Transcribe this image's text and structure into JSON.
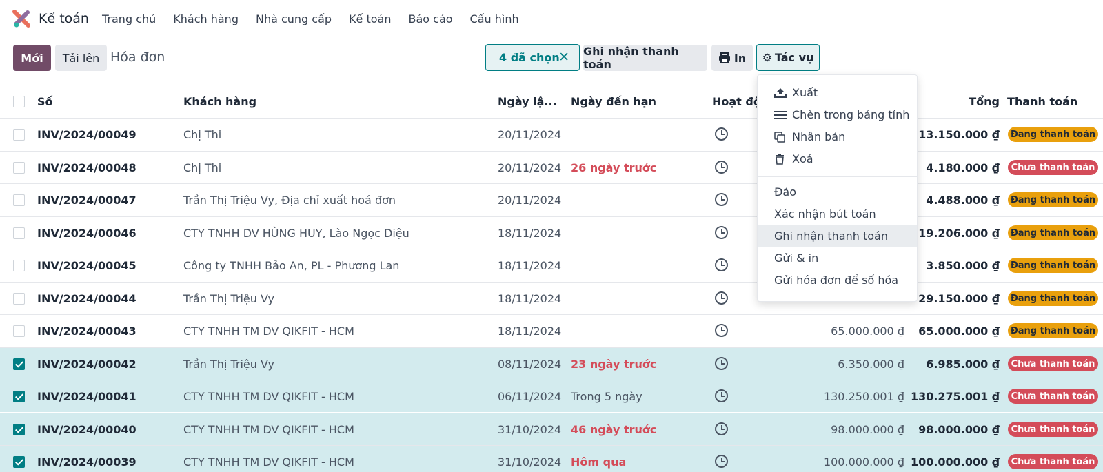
{
  "nav": {
    "app_title": "Kế toán",
    "menu": [
      "Trang chủ",
      "Khách hàng",
      "Nhà cung cấp",
      "Kế toán",
      "Báo cáo",
      "Cấu hình"
    ]
  },
  "control": {
    "new_label": "Mới",
    "upload_label": "Tải lên",
    "breadcrumb": "Hóa đơn",
    "selected_label": "4 đã chọn",
    "register_payment_label": "Ghi nhận thanh toán",
    "print_label": "In",
    "actions_label": "Tác vụ"
  },
  "table": {
    "headers": {
      "number": "Số",
      "customer": "Khách hàng",
      "invoice_date": "Ngày lậ...",
      "due_date": "Ngày đến hạn",
      "activity": "Hoạt độn",
      "total": "Tổng",
      "payment": "Thanh toán"
    },
    "rows": [
      {
        "number": "INV/2024/00049",
        "customer": "Chị Thi",
        "date": "20/11/2024",
        "due": "",
        "untaxed": "",
        "total": "13.150.000 ₫",
        "status": "Đang thanh toán",
        "selected": false
      },
      {
        "number": "INV/2024/00048",
        "customer": "Chị Thi",
        "date": "20/11/2024",
        "due": "26 ngày trước",
        "untaxed": "",
        "total": "4.180.000 ₫",
        "status": "Chưa thanh toán",
        "selected": false
      },
      {
        "number": "INV/2024/00047",
        "customer": "Trần Thị Triệu Vy, Địa chỉ xuất hoá đơn",
        "date": "20/11/2024",
        "due": "",
        "untaxed": "",
        "total": "4.488.000 ₫",
        "status": "Đang thanh toán",
        "selected": false
      },
      {
        "number": "INV/2024/00046",
        "customer": "CTY TNHH DV HÙNG HUY, Lào Ngọc Diệu",
        "date": "18/11/2024",
        "due": "",
        "untaxed": "",
        "total": "19.206.000 ₫",
        "status": "Đang thanh toán",
        "selected": false
      },
      {
        "number": "INV/2024/00045",
        "customer": "Công ty TNHH Bảo An, PL - Phương Lan",
        "date": "18/11/2024",
        "due": "",
        "untaxed": "",
        "total": "3.850.000 ₫",
        "status": "Đang thanh toán",
        "selected": false
      },
      {
        "number": "INV/2024/00044",
        "customer": "Trần Thị Triệu Vy",
        "date": "18/11/2024",
        "due": "",
        "untaxed": "",
        "total": "29.150.000 ₫",
        "status": "Đang thanh toán",
        "selected": false
      },
      {
        "number": "INV/2024/00043",
        "customer": "CTY TNHH TM DV QIKFIT - HCM",
        "date": "18/11/2024",
        "due": "",
        "untaxed": "65.000.000 ₫",
        "total": "65.000.000 ₫",
        "status": "Đang thanh toán",
        "selected": false
      },
      {
        "number": "INV/2024/00042",
        "customer": "Trần Thị Triệu Vy",
        "date": "08/11/2024",
        "due": "23 ngày trước",
        "untaxed": "6.350.000 ₫",
        "total": "6.985.000 ₫",
        "status": "Chưa thanh toán",
        "selected": true
      },
      {
        "number": "INV/2024/00041",
        "customer": "CTY TNHH TM DV QIKFIT - HCM",
        "date": "06/11/2024",
        "due": "Trong 5 ngày",
        "untaxed": "130.250.001 ₫",
        "total": "130.275.001 ₫",
        "status": "Chưa thanh toán",
        "selected": true
      },
      {
        "number": "INV/2024/00040",
        "customer": "CTY TNHH TM DV QIKFIT - HCM",
        "date": "31/10/2024",
        "due": "46 ngày trước",
        "untaxed": "98.000.000 ₫",
        "total": "98.000.000 ₫",
        "status": "Chưa thanh toán",
        "selected": true
      },
      {
        "number": "INV/2024/00039",
        "customer": "CTY TNHH TM DV QIKFIT - HCM",
        "date": "31/10/2024",
        "due": "Hôm qua",
        "untaxed": "100.000.000 ₫",
        "total": "100.000.000 ₫",
        "status": "Chưa thanh toán",
        "selected": true
      }
    ]
  },
  "dropdown": {
    "export": "Xuất",
    "insert_sheet": "Chèn trong bảng tính",
    "duplicate": "Nhân bản",
    "delete": "Xoá",
    "reverse": "Đảo",
    "confirm_entries": "Xác nhận bút toán",
    "register_payment": "Ghi nhận thanh toán",
    "send_print": "Gửi & in",
    "send_digitize": "Gửi hóa đơn để số hóa"
  },
  "colors": {
    "primary": "#714b67",
    "accent": "#017e84",
    "warning": "#e9a00d",
    "danger": "#d44c59",
    "selected_row": "#d3ebee"
  }
}
